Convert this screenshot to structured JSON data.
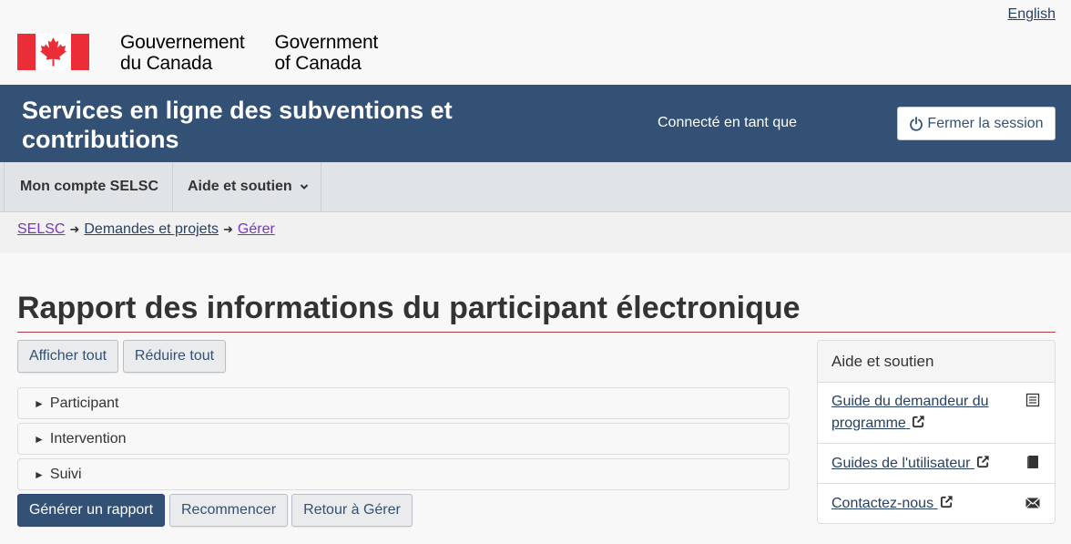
{
  "header": {
    "lang_toggle": "English",
    "fip_fr": [
      "Gouvernement",
      "du Canada"
    ],
    "fip_en": [
      "Government",
      "of Canada"
    ]
  },
  "titlebar": {
    "app_title": "Services en ligne des subventions et contributions",
    "signed_in_text": "Connecté en tant que",
    "signout_label": "Fermer la session"
  },
  "menu": {
    "items": [
      {
        "label": "Mon compte SELSC"
      },
      {
        "label": "Aide et soutien"
      }
    ]
  },
  "breadcrumb": {
    "items": [
      {
        "label": "SELSC"
      },
      {
        "label": "Demandes et projets"
      },
      {
        "label": "Gérer"
      }
    ]
  },
  "page": {
    "title": "Rapport des informations du participant électronique",
    "expand_all": "Afficher tout",
    "collapse_all": "Réduire tout",
    "sections": [
      {
        "label": "Participant"
      },
      {
        "label": "Intervention"
      },
      {
        "label": "Suivi"
      }
    ],
    "generate": "Générer un rapport",
    "reset": "Recommencer",
    "back": "Retour à Gérer"
  },
  "help_panel": {
    "title": "Aide et soutien",
    "links": [
      {
        "label": "Guide du demandeur du programme",
        "icon": "list-icon"
      },
      {
        "label": "Guides de l'utilisateur",
        "icon": "book-icon"
      },
      {
        "label": "Contactez-nous",
        "icon": "envelope-icon"
      }
    ]
  },
  "colors": {
    "brand_blue": "#335075",
    "flag_red": "#eb2d37",
    "title_rule": "#af3c43",
    "visited_link": "#7834bc"
  }
}
